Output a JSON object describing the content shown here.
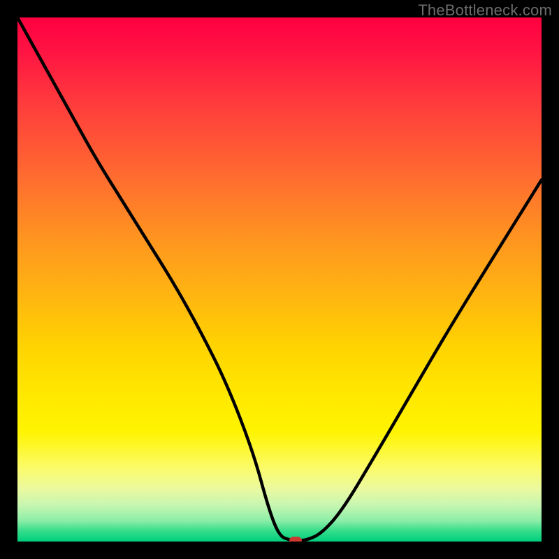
{
  "watermark": "TheBottleneck.com",
  "colors": {
    "gradient_top": "#ff0040",
    "gradient_bottom": "#00cf7f",
    "curve_stroke": "#000000",
    "marker_fill": "#cc3a30",
    "frame_bg": "#000000"
  },
  "chart_data": {
    "type": "line",
    "title": "",
    "xlabel": "",
    "ylabel": "",
    "xlim": [
      0,
      100
    ],
    "ylim": [
      0,
      100
    ],
    "grid": false,
    "legend": false,
    "series": [
      {
        "name": "bottleneck-curve",
        "x": [
          0,
          5,
          10,
          15,
          20,
          25,
          30,
          35,
          40,
          45,
          48,
          50,
          52,
          53,
          55,
          58,
          62,
          68,
          75,
          82,
          90,
          100
        ],
        "y": [
          100,
          91,
          82,
          73,
          65,
          57,
          49,
          40,
          30,
          17,
          6,
          1,
          0.3,
          0.2,
          0.2,
          1.5,
          6,
          16,
          28,
          40,
          53,
          69
        ]
      }
    ],
    "marker": {
      "x": 53,
      "y": 0.2,
      "shape": "rounded-rect",
      "color": "#cc3a30"
    },
    "notes": "Values are estimated from pixel positions; axes have no tick labels in the image so x/y are expressed as 0–100 percent of the plot area. y=0 is the bottom (green) edge, y=100 is the top (red) edge."
  }
}
